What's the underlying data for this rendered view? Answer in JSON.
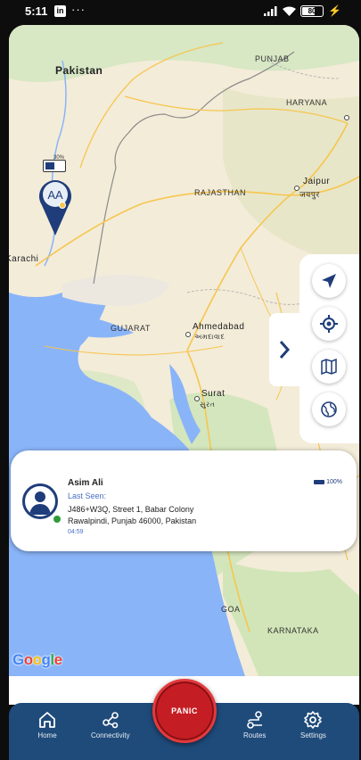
{
  "status_bar": {
    "time": "5:11",
    "app_badge": "in",
    "more": "···",
    "battery": "80"
  },
  "map": {
    "labels": {
      "pakistan": "Pakistan",
      "punjab": "PUNJAB",
      "haryana": "HARYANA",
      "rajasthan": "RAJASTHAN",
      "jaipur": "Jaipur",
      "jaipur_local": "जयपुर",
      "karachi": "Karachi",
      "gujarat": "GUJARAT",
      "ahmedabad": "Ahmedabad",
      "ahmedabad_local": "અમદાવાદ",
      "surat": "Surat",
      "surat_local": "સુરત",
      "goa": "GOA",
      "karnataka": "KARNATAKA"
    },
    "marker_initials": "AA",
    "marker_battery": "30%",
    "attribution": "Google"
  },
  "map_controls": {
    "icons": [
      "navigation-arrow-icon",
      "my-location-icon",
      "map-layers-icon",
      "globe-icon"
    ],
    "collapse_icon": "chevron-right-icon"
  },
  "user_card": {
    "name": "Asim Ali",
    "last_seen_label": "Last Seen:",
    "address_line1": "J486+W3Q, Street 1, Babar Colony",
    "address_line2": "Rawalpindi, Punjab 46000, Pakistan",
    "time_ago": "04:59",
    "battery": "100%"
  },
  "bottom_nav": {
    "items": [
      {
        "label": "Home",
        "icon": "home-icon"
      },
      {
        "label": "Connectivity",
        "icon": "connectivity-icon"
      },
      {
        "label": "Routes",
        "icon": "routes-icon"
      },
      {
        "label": "Settings",
        "icon": "settings-gear-icon"
      }
    ],
    "panic_label": "PANIC"
  },
  "colors": {
    "primary": "#1f4b7a",
    "panic": "#c41e24",
    "sea": "#8ab4f8",
    "land": "#f3ecd9"
  }
}
